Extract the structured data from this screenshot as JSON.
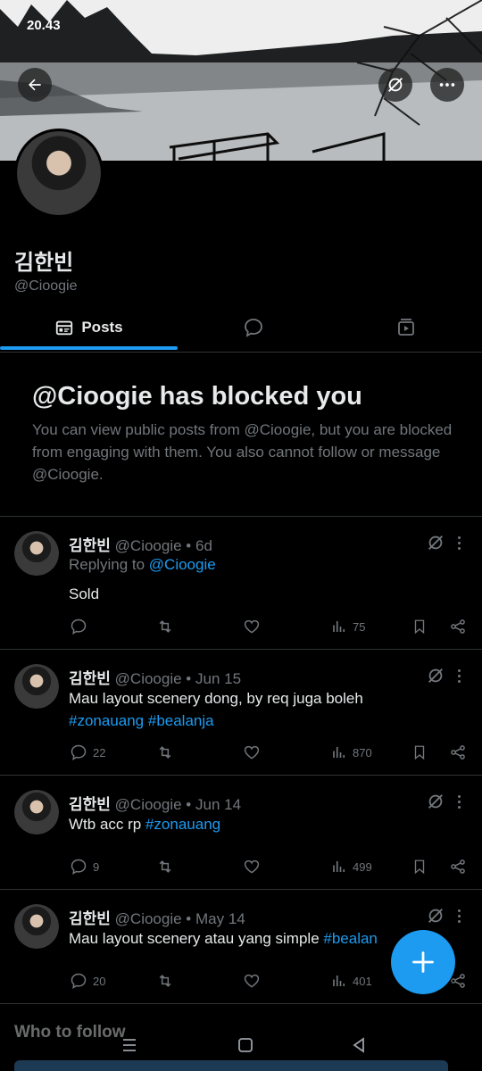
{
  "status_bar": {
    "time": "20.43"
  },
  "profile": {
    "display_name": "김한빈",
    "handle": "@Cioogie"
  },
  "tabs": [
    {
      "label": "Posts",
      "icon": "posts-icon",
      "active": true
    },
    {
      "label": "",
      "icon": "replies-bubble-icon",
      "active": false
    },
    {
      "label": "",
      "icon": "media-icon",
      "active": false
    }
  ],
  "blocked_notice": {
    "title": "@Cioogie has blocked you",
    "text": "You can view public posts from @Cioogie, but you are blocked from engaging with them. You also cannot follow or message @Cioogie."
  },
  "posts": [
    {
      "name": "김한빈",
      "handle": "@Cioogie",
      "sep": "•",
      "time": "6d",
      "reply_prefix": "Replying to ",
      "reply_to": "@Cioogie",
      "text": "Sold",
      "hashtags": "",
      "replies": "",
      "views": "75"
    },
    {
      "name": "김한빈",
      "handle": "@Cioogie",
      "sep": "•",
      "time": "Jun 15",
      "text": "Mau layout scenery dong, by req juga boleh",
      "hashtags": "#zonauang #bealanja",
      "replies": "22",
      "views": "870"
    },
    {
      "name": "김한빈",
      "handle": "@Cioogie",
      "sep": "•",
      "time": "Jun 14",
      "text": "Wtb acc rp ",
      "hashtags": "#zonauang",
      "replies": "9",
      "views": "499"
    },
    {
      "name": "김한빈",
      "handle": "@Cioogie",
      "sep": "•",
      "time": "May 14",
      "text": "Mau layout scenery atau yang simple ",
      "hashtags": "#bealan",
      "replies": "20",
      "views": "401"
    }
  ],
  "who_to_follow": "Who to follow",
  "colors": {
    "accent": "#1d9bf0",
    "muted": "#71767b",
    "text": "#e7e9ea",
    "background": "#000000"
  }
}
